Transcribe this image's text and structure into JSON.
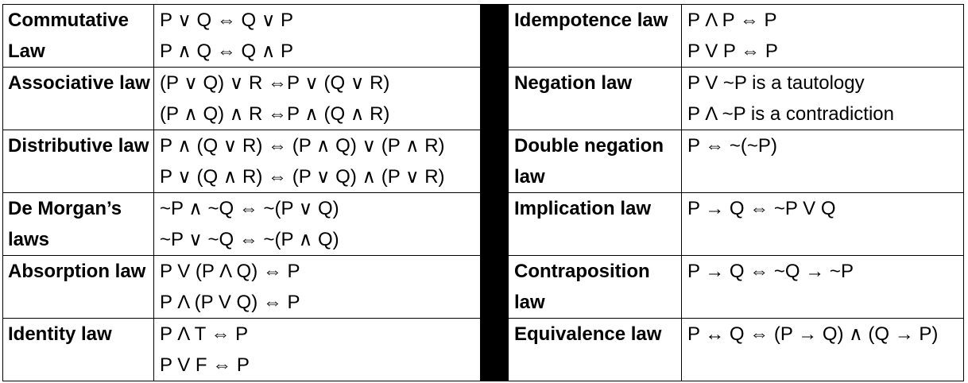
{
  "rows": [
    {
      "left_name": "Commutative Law",
      "left_lines": [
        "P ∨ Q ⇔ Q ∨ P",
        "P ∧ Q ⇔ Q ∧ P"
      ],
      "right_name": "Idempotence law",
      "right_lines": [
        "P Λ P ⇔ P",
        "P V P ⇔ P"
      ]
    },
    {
      "left_name": "Associative law",
      "left_lines": [
        "(P ∨ Q) ∨ R ⇔P ∨ (Q ∨ R)",
        "(P ∧ Q) ∧ R ⇔P ∧ (Q ∧ R)"
      ],
      "right_name": "Negation law",
      "right_lines": [
        "P V ~P is a tautology",
        "P Λ ~P is a contradiction"
      ]
    },
    {
      "left_name": "Distributive law",
      "left_lines": [
        "P ∧ (Q ∨ R) ⇔ (P ∧ Q) ∨ (P ∧ R)",
        "P ∨ (Q ∧ R) ⇔ (P ∨ Q) ∧ (P ∨ R)"
      ],
      "right_name": "Double negation law",
      "right_lines": [
        "P ⇔ ~(~P)"
      ]
    },
    {
      "left_name": "De Morgan’s laws",
      "left_lines": [
        "~P ∧ ~Q ⇔ ~(P ∨ Q)",
        "~P ∨ ~Q ⇔ ~(P ∧  Q)"
      ],
      "right_name": "Implication law",
      "right_lines": [
        "P → Q ⇔ ~P V Q"
      ]
    },
    {
      "left_name": "Absorption law",
      "left_lines": [
        "P V (P Λ Q) ⇔ P",
        "P Λ (P V Q) ⇔ P"
      ],
      "right_name": "Contraposition law",
      "right_lines": [
        "P → Q ⇔ ~Q → ~P"
      ]
    },
    {
      "left_name": "Identity law",
      "left_lines": [
        "P Λ T ⇔ P",
        "P V F ⇔ P"
      ],
      "right_name": "Equivalence law",
      "right_lines": [
        "P ↔ Q ⇔ (P → Q) ∧ (Q → P)"
      ]
    }
  ]
}
